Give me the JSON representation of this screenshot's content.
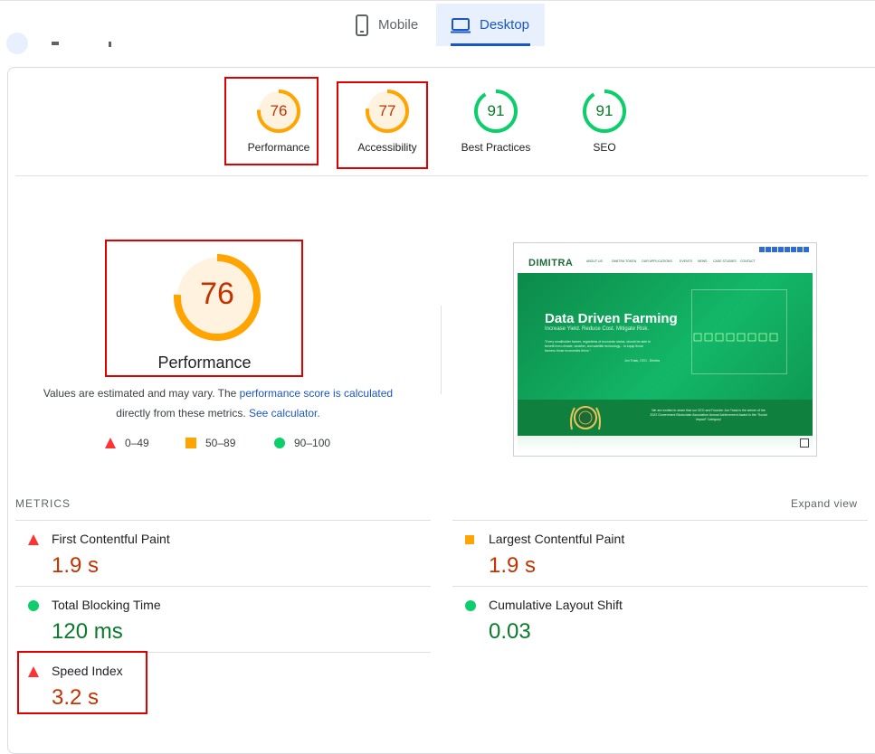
{
  "tabs": [
    {
      "label": "Mobile",
      "active": false
    },
    {
      "label": "Desktop",
      "active": true
    }
  ],
  "gauges": [
    {
      "score": "76",
      "label": "Performance",
      "color": "#ffa400",
      "fill": "#fff3e0",
      "text_color": "#c33300",
      "value": 0.76
    },
    {
      "score": "77",
      "label": "Accessibility",
      "color": "#ffa400",
      "fill": "#fff3e0",
      "text_color": "#c33300",
      "value": 0.77
    },
    {
      "score": "91",
      "label": "Best Practices",
      "color": "#0cce6b",
      "fill": "#ffffff",
      "text_color": "#0a7a2c",
      "value": 0.91
    },
    {
      "score": "91",
      "label": "SEO",
      "color": "#0cce6b",
      "fill": "#ffffff",
      "text_color": "#0a7a2c",
      "value": 0.91
    }
  ],
  "main_score": {
    "score": "76",
    "label": "Performance",
    "value": 0.76
  },
  "description": {
    "part1": "Values are estimated and may vary. The ",
    "link1": "performance score is calculated",
    "part2": "directly from these metrics. ",
    "link2": "See calculator."
  },
  "legend": [
    {
      "range": "0–49",
      "shape": "triangle",
      "color": "#ff3333"
    },
    {
      "range": "50–89",
      "shape": "square",
      "color": "#ffa400"
    },
    {
      "range": "90–100",
      "shape": "circle",
      "color": "#0cce6b"
    }
  ],
  "preview": {
    "logo": "DIMITRA",
    "nav": [
      "ABOUT US",
      "DIMITRA TOKEN",
      "OUR APPLICATIONS",
      "EVENTS",
      "NEWS",
      "CASE STUDIES",
      "CONTACT"
    ],
    "hero_title": "Data Driven Farming",
    "hero_sub": "Increase Yield. Reduce Cost. Mitigate Risk.",
    "hero_quote": "\"Every smallholder farmer, regardless of economic status, should be able to benefit from climate, weather, and satellite technology... to equip those farmers those economies thrive.\"",
    "hero_author": "Jon Trask, CEO - Dimitra",
    "award_text": "We are excited to share that our CEO and Founder Jon Trask is the winner of the 2022 Government Blockchain Association Annual Achievement Award in the \"Social Impact\" Category!"
  },
  "metrics_header": "METRICS",
  "expand_view": "Expand view",
  "metrics": [
    {
      "name": "First Contentful Paint",
      "value": "1.9 s",
      "status": "fail"
    },
    {
      "name": "Largest Contentful Paint",
      "value": "1.9 s",
      "status": "average"
    },
    {
      "name": "Total Blocking Time",
      "value": "120 ms",
      "status": "pass"
    },
    {
      "name": "Cumulative Layout Shift",
      "value": "0.03",
      "status": "pass"
    },
    {
      "name": "Speed Index",
      "value": "3.2 s",
      "status": "fail"
    }
  ]
}
